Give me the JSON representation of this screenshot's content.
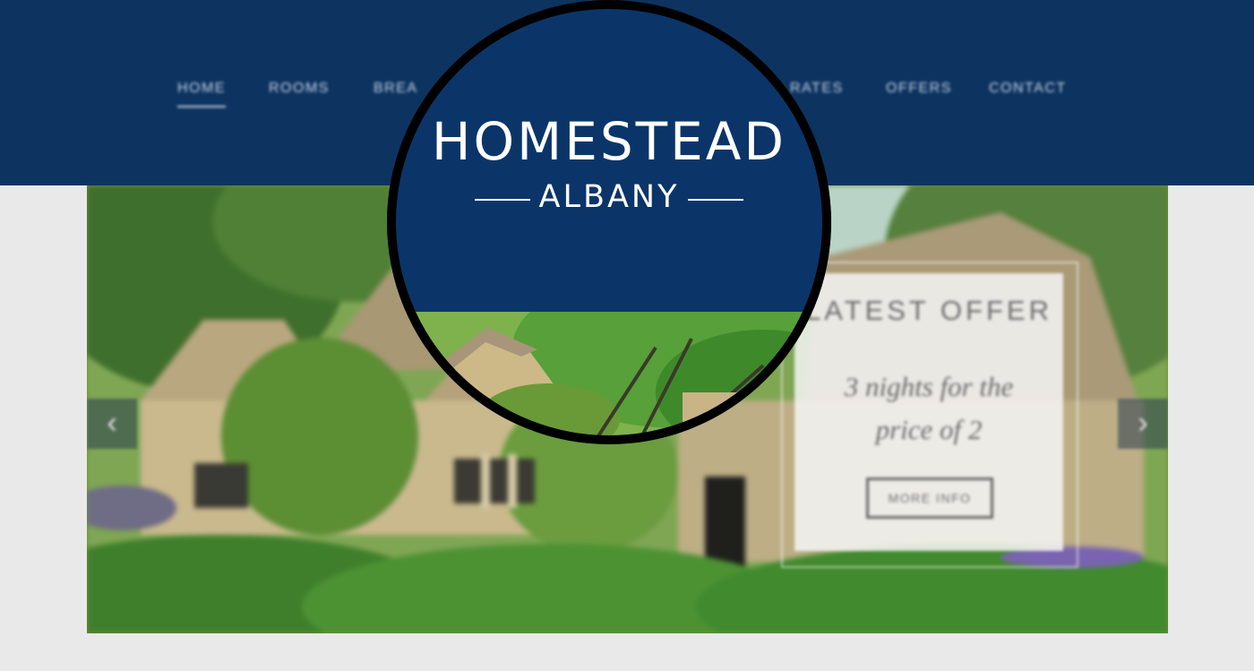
{
  "nav": {
    "items": [
      {
        "label": "HOME",
        "active": true
      },
      {
        "label": "ROOMS",
        "active": false
      },
      {
        "label": "BREA",
        "active": false
      },
      {
        "label": "RATES",
        "active": false
      },
      {
        "label": "OFFERS",
        "active": false
      },
      {
        "label": "CONTACT",
        "active": false
      }
    ]
  },
  "brand": {
    "name": "HOMESTEAD",
    "location": "ALBANY"
  },
  "hero": {
    "prev_icon": "chevron-left-icon",
    "next_icon": "chevron-right-icon",
    "prev_glyph": "‹",
    "next_glyph": "›"
  },
  "offer": {
    "title": "LATEST OFFER",
    "text": "3 nights for the price of 2",
    "button": "MORE INFO"
  },
  "colors": {
    "header": "#0d3460",
    "brand_blue": "#0b3569",
    "page_bg": "#e9e9e9"
  }
}
